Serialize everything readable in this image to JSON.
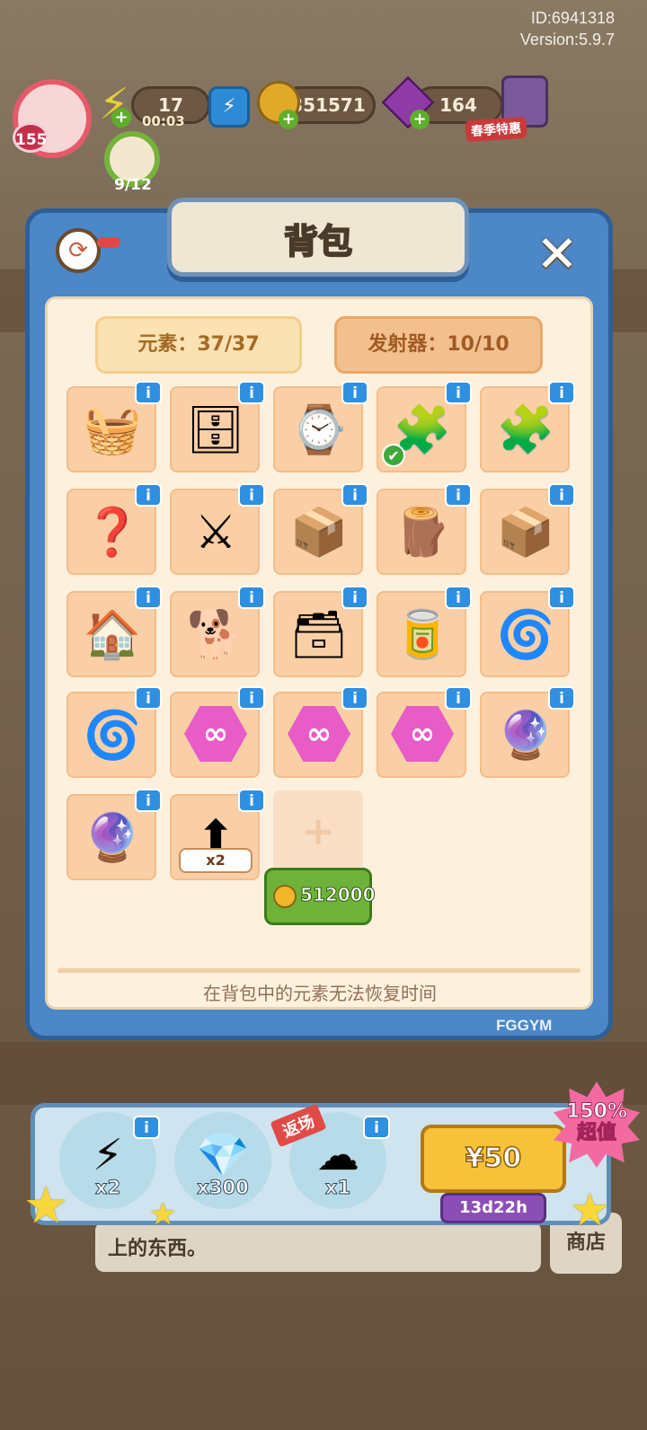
{
  "meta": {
    "id": "ID:6941318",
    "version": "Version:5.9.7"
  },
  "hud": {
    "level": "155",
    "energy": "17",
    "energy_timer": "00:03",
    "coins": "351571",
    "gems": "164",
    "spring_badge": "春季特惠",
    "task_progress": "9/12"
  },
  "panel": {
    "title": "背包",
    "tab_elements": "元素：37/37",
    "tab_emitters": "发射器：10/10",
    "footnote": "在背包中的元素无法恢复时间",
    "expand_price": "512000",
    "brand": "FGGYM"
  },
  "items": [
    {
      "name": "shopping-basket",
      "icon": "🧺",
      "info": "i"
    },
    {
      "name": "wooden-cabinet",
      "icon": "🗄",
      "info": "i"
    },
    {
      "name": "fox-bracelet",
      "icon": "⌚",
      "info": "i"
    },
    {
      "name": "puzzle-pieces",
      "icon": "🧩",
      "info": "i",
      "check": true
    },
    {
      "name": "puzzle-pile",
      "icon": "🧩",
      "info": "i"
    },
    {
      "name": "mystery-puzzle",
      "icon": "❓",
      "info": "i"
    },
    {
      "name": "warrior-figure",
      "icon": "⚔",
      "info": "i"
    },
    {
      "name": "leaf-bags",
      "icon": "📦",
      "info": "i"
    },
    {
      "name": "wooden-boards",
      "icon": "🪵",
      "info": "i"
    },
    {
      "name": "cardboard-doghouse",
      "icon": "📦",
      "info": "i"
    },
    {
      "name": "wooden-doghouse",
      "icon": "🏠",
      "info": "i"
    },
    {
      "name": "border-collie",
      "icon": "🐕",
      "info": "i"
    },
    {
      "name": "paper-cabinet",
      "icon": "🗃",
      "info": "i"
    },
    {
      "name": "canister",
      "icon": "🥫",
      "info": "i"
    },
    {
      "name": "purple-portal",
      "icon": "🌀",
      "info": "i"
    },
    {
      "name": "purple-portal-2",
      "icon": "🌀",
      "info": "i"
    },
    {
      "name": "infinity-hex-1",
      "icon": "∞",
      "info": "i",
      "hex": true
    },
    {
      "name": "infinity-hex-2",
      "icon": "∞",
      "info": "i",
      "hex": true
    },
    {
      "name": "infinity-hex-3",
      "icon": "∞",
      "info": "i",
      "hex": true
    },
    {
      "name": "gumball-machine",
      "icon": "🔮",
      "info": "i"
    },
    {
      "name": "gumball-machine-red",
      "icon": "🔮",
      "info": "i"
    },
    {
      "name": "upgrade-ticket",
      "icon": "⬆",
      "info": "i",
      "qty": "x2"
    }
  ],
  "shop": {
    "offer1_label": "x2",
    "offer2_label": "x300",
    "offer3_label": "x1",
    "new_tag": "返场",
    "price": "¥50",
    "timer": "13d22h",
    "burst_line1": "150%",
    "burst_line2": "超值"
  },
  "underlay": {
    "text": "上的东西。",
    "shop": "商店"
  },
  "colors": {
    "panel_blue": "#4c87c7",
    "info_blue": "#2f8fe0",
    "cell_peach": "#fbcfa6",
    "buy_green": "#6fb23a"
  }
}
